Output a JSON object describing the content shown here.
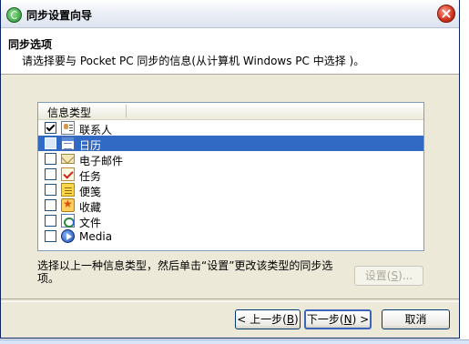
{
  "window": {
    "title": "同步设置向导"
  },
  "header": {
    "title": "同步选项",
    "description": "请选择要与 Pocket PC 同步的信息(从计算机 Windows PC 中选择 )。"
  },
  "list": {
    "column_header": "信息类型",
    "items": [
      {
        "label": "联系人",
        "checked": true,
        "selected": false,
        "icon": "contacts-icon"
      },
      {
        "label": "日历",
        "checked": false,
        "selected": true,
        "icon": "calendar-icon"
      },
      {
        "label": "电子邮件",
        "checked": false,
        "selected": false,
        "icon": "email-icon"
      },
      {
        "label": "任务",
        "checked": false,
        "selected": false,
        "icon": "tasks-icon"
      },
      {
        "label": "便笺",
        "checked": false,
        "selected": false,
        "icon": "notes-icon"
      },
      {
        "label": "收藏",
        "checked": false,
        "selected": false,
        "icon": "favorites-icon"
      },
      {
        "label": "文件",
        "checked": false,
        "selected": false,
        "icon": "files-icon"
      },
      {
        "label": "Media",
        "checked": false,
        "selected": false,
        "icon": "media-icon"
      }
    ]
  },
  "hint": "选择以上一种信息类型，然后单击“设置”更改该类型的同步选项。",
  "buttons": {
    "settings": {
      "label": "设置",
      "accel": "S",
      "suffix": "..."
    },
    "back": {
      "label": "< 上一步",
      "accel": "B"
    },
    "next": {
      "label": "下一步",
      "accel": "N",
      "suffix": " >"
    },
    "cancel": {
      "label": "取消"
    }
  },
  "colors": {
    "selection": "#316ac5",
    "window_bg": "#ece9d8"
  }
}
